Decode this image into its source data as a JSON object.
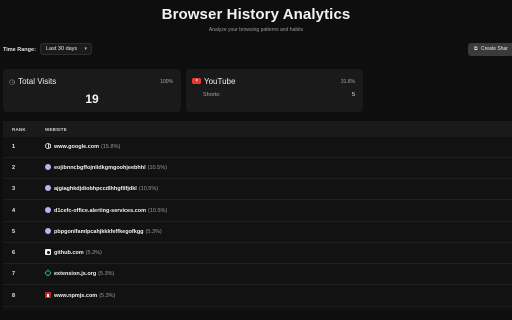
{
  "header": {
    "title": "Browser History Analytics",
    "subtitle": "Analyze your browsing patterns and habits"
  },
  "controls": {
    "time_range_label": "Time Range:",
    "time_range_value": "Last 30 days",
    "share_button_label": "Create Shar"
  },
  "cards": {
    "total": {
      "label": "Total Visits",
      "percent": "100%",
      "value": "19",
      "icon": "clock-icon"
    },
    "youtube": {
      "label": "YouTube",
      "percent": "31.6%",
      "shorts_label": "Shorts:",
      "shorts_value": "5",
      "icon": "youtube-icon"
    }
  },
  "table": {
    "columns": [
      "RANK",
      "WEBSITE"
    ],
    "rows": [
      {
        "rank": "1",
        "domain": "www.google.com",
        "share": "(15.8%)",
        "icon": "globe-icon"
      },
      {
        "rank": "2",
        "domain": "eojibnncbgffojnlidkgmgoohjeebhhl",
        "share": "(10.5%)",
        "icon": "extension-icon"
      },
      {
        "rank": "3",
        "domain": "ajgiaghkdjdiobhpccdlhhgfilfjdkl",
        "share": "(10.5%)",
        "icon": "extension-icon"
      },
      {
        "rank": "4",
        "domain": "d1cefc-office.alerting-services.com",
        "share": "(10.5%)",
        "icon": "extension-icon"
      },
      {
        "rank": "5",
        "domain": "pbpgonlfamlpcahjkkkfeffkegofkgg",
        "share": "(5.3%)",
        "icon": "extension-icon"
      },
      {
        "rank": "6",
        "domain": "github.com",
        "share": "(5.3%)",
        "icon": "github-icon"
      },
      {
        "rank": "7",
        "domain": "extension.js.org",
        "share": "(5.3%)",
        "icon": "extensionjs-icon"
      },
      {
        "rank": "8",
        "domain": "www.npmjs.com",
        "share": "(5.3%)",
        "icon": "npm-icon"
      }
    ]
  },
  "colors": {
    "background": "#0e0e0e",
    "card": "#1a1a1a",
    "youtube_red": "#e53935",
    "npm_red": "#c12127",
    "js_green": "#2ebf6b"
  }
}
